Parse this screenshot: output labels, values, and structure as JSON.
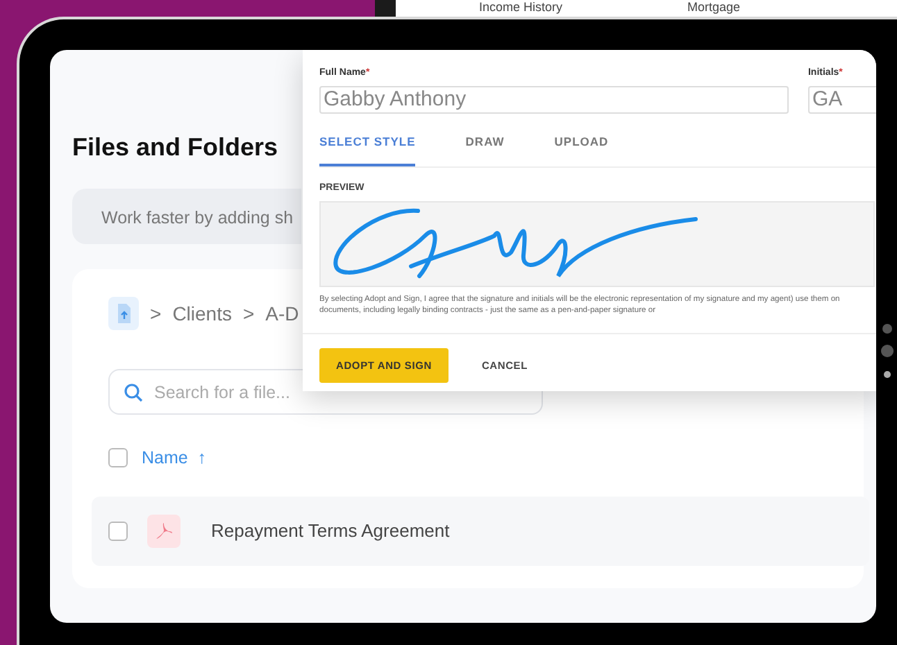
{
  "background_page": {
    "tabs": [
      "Income History",
      "Mortgage"
    ]
  },
  "page": {
    "title": "Files and Folders",
    "banner": "Work faster by adding sh",
    "breadcrumb": {
      "separator": ">",
      "items": [
        "Clients",
        "A-D"
      ]
    },
    "search": {
      "placeholder": "Search for a file..."
    },
    "table": {
      "header": {
        "label": "Name",
        "sort": "↑",
        "checked": false
      },
      "rows": [
        {
          "name": "Repayment Terms Agreement",
          "checked": false
        }
      ]
    }
  },
  "dialog": {
    "fields": [
      {
        "label": "Full Name",
        "required_mark": "*",
        "value": "Gabby Anthony"
      },
      {
        "label": "Initials",
        "required_mark": "*",
        "value": "GA"
      }
    ],
    "tabs": [
      {
        "label": "SELECT STYLE",
        "selected": true
      },
      {
        "label": "DRAW",
        "selected": false
      },
      {
        "label": "UPLOAD",
        "selected": false
      }
    ],
    "preview_label": "PREVIEW",
    "disclaimer": "By selecting Adopt and Sign, I agree that the signature and initials will be the electronic representation of my signature and my agent) use them on documents, including legally binding contracts - just the same as a pen-and-paper signature or",
    "buttons": [
      {
        "label": "ADOPT AND SIGN",
        "kind": "primary"
      },
      {
        "label": "CANCEL",
        "kind": "link"
      }
    ]
  }
}
